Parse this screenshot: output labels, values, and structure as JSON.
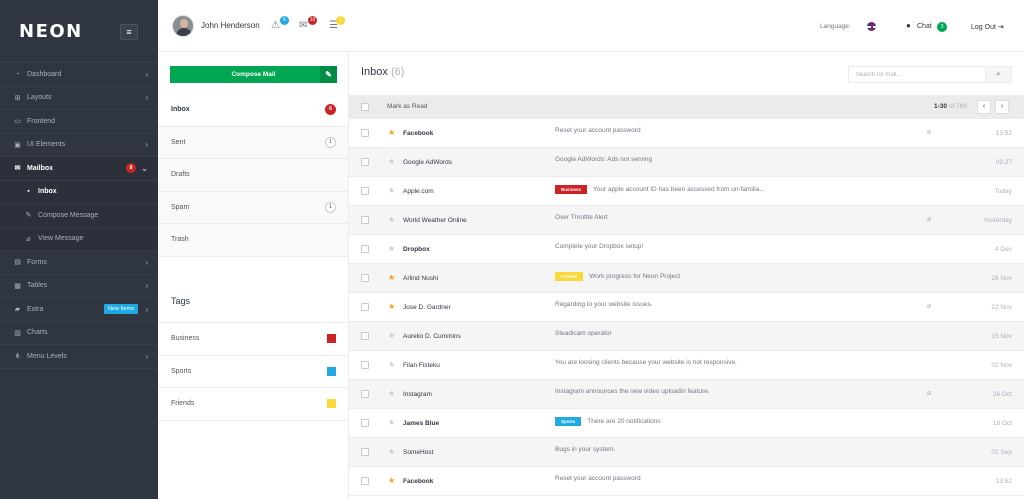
{
  "brand": {
    "logo": "NEON"
  },
  "sidebar": {
    "items": [
      {
        "label": "Dashboard",
        "icon": "gauge-icon",
        "glyph": "◔",
        "chevron": "›"
      },
      {
        "label": "Layouts",
        "icon": "grid-icon",
        "glyph": "⊞",
        "chevron": "›"
      },
      {
        "label": "Frontend",
        "icon": "monitor-icon",
        "glyph": "▭",
        "chevron": ""
      },
      {
        "label": "UI Elements",
        "icon": "layers-icon",
        "glyph": "▣",
        "chevron": "›"
      },
      {
        "label": "Mailbox",
        "icon": "mail-icon",
        "glyph": "✉",
        "chevron": "⌄",
        "badge": "8"
      },
      {
        "label": "Inbox",
        "icon": "inbox-icon",
        "glyph": "▪",
        "sub": true
      },
      {
        "label": "Compose Message",
        "icon": "pencil-icon",
        "glyph": "✎",
        "sub": true
      },
      {
        "label": "View Message",
        "icon": "paperclip-icon",
        "glyph": "⌀",
        "sub": true
      },
      {
        "label": "Forms",
        "icon": "doc-icon",
        "glyph": "▤",
        "chevron": "›"
      },
      {
        "label": "Tables",
        "icon": "table-icon",
        "glyph": "▦",
        "chevron": "›"
      },
      {
        "label": "Extra",
        "icon": "bag-icon",
        "glyph": "▰",
        "chevron": "›",
        "badge_label": "New Items"
      },
      {
        "label": "Charts",
        "icon": "chart-icon",
        "glyph": "▥",
        "chevron": ""
      },
      {
        "label": "Menu Levels",
        "icon": "sitemap-icon",
        "glyph": "⋔",
        "chevron": "›"
      }
    ]
  },
  "header": {
    "user_name": "John Henderson",
    "notif_badges": [
      "6",
      "10",
      "1"
    ],
    "language_label": "Language:",
    "chat_label": "Chat",
    "chat_count": "3",
    "logout_label": "Log Out"
  },
  "mail_sidebar": {
    "compose_label": "Compose Mail",
    "folders": [
      {
        "label": "Inbox",
        "count": "6"
      },
      {
        "label": "Sent",
        "count": "1"
      },
      {
        "label": "Drafts",
        "count": ""
      },
      {
        "label": "Spam",
        "count": "1"
      },
      {
        "label": "Trash",
        "count": ""
      }
    ],
    "tags_title": "Tags",
    "tags": [
      {
        "label": "Business",
        "color": "#cc2424"
      },
      {
        "label": "Sports",
        "color": "#21a9e1"
      },
      {
        "label": "Friends",
        "color": "#fad839"
      }
    ]
  },
  "mail_main": {
    "title": "Inbox",
    "title_count": "(6)",
    "search_placeholder": "Search for mail...",
    "mark_as_read": "Mark as Read",
    "pager_range": "1-30",
    "pager_of": "of 789",
    "prev": "‹",
    "next": "›",
    "rows": [
      {
        "sender": "Facebook",
        "subject": "Reset your account password",
        "time": "13:52",
        "starred": true,
        "unread": true,
        "attach": true
      },
      {
        "sender": "Google AdWords",
        "subject": "Google AdWords: Ads not serving",
        "time": "09:27",
        "starred": false,
        "unread": false,
        "attach": false
      },
      {
        "sender": "Apple.com",
        "subject": "Your apple account ID has been accessed from un-familia...",
        "time": "Today",
        "starred": false,
        "unread": false,
        "attach": false,
        "label": "Business",
        "label_color": "#cc2424"
      },
      {
        "sender": "World Weather Online",
        "subject": "Over Throttle Alert",
        "time": "Yesterday",
        "starred": false,
        "unread": false,
        "attach": true
      },
      {
        "sender": "Dropbox",
        "subject": "Complete your Dropbox setup!",
        "time": "4 Dec",
        "starred": false,
        "unread": true,
        "attach": false
      },
      {
        "sender": "Arlind Nushi",
        "subject": "Work progress for Neon Project",
        "time": "28 Nov",
        "starred": true,
        "unread": false,
        "attach": false,
        "label": "Friends",
        "label_color": "#fad839"
      },
      {
        "sender": "Jose D. Gardner",
        "subject": "Regarding to your website issues.",
        "time": "22 Nov",
        "starred": true,
        "unread": false,
        "attach": true
      },
      {
        "sender": "Aurelio D. Cummins",
        "subject": "Steadicam operator",
        "time": "15 Nov",
        "starred": false,
        "unread": false,
        "attach": false
      },
      {
        "sender": "Filan Fisteku",
        "subject": "You are loosing clients because your website is not responsive.",
        "time": "02 Nov",
        "starred": false,
        "unread": false,
        "attach": false
      },
      {
        "sender": "Instagram",
        "subject": "Instagram announces the new video uploadin feature.",
        "time": "26 Oct",
        "starred": false,
        "unread": false,
        "attach": true
      },
      {
        "sender": "James Blue",
        "subject": "There are 20 notifications",
        "time": "18 Oct",
        "starred": false,
        "unread": true,
        "attach": false,
        "label": "Sports",
        "label_color": "#21a9e1"
      },
      {
        "sender": "SomeHost",
        "subject": "Bugs in your system.",
        "time": "01 Sep",
        "starred": false,
        "unread": false,
        "attach": false
      },
      {
        "sender": "Facebook",
        "subject": "Reset your account password",
        "time": "13:52",
        "starred": true,
        "unread": true,
        "attach": false
      }
    ]
  }
}
